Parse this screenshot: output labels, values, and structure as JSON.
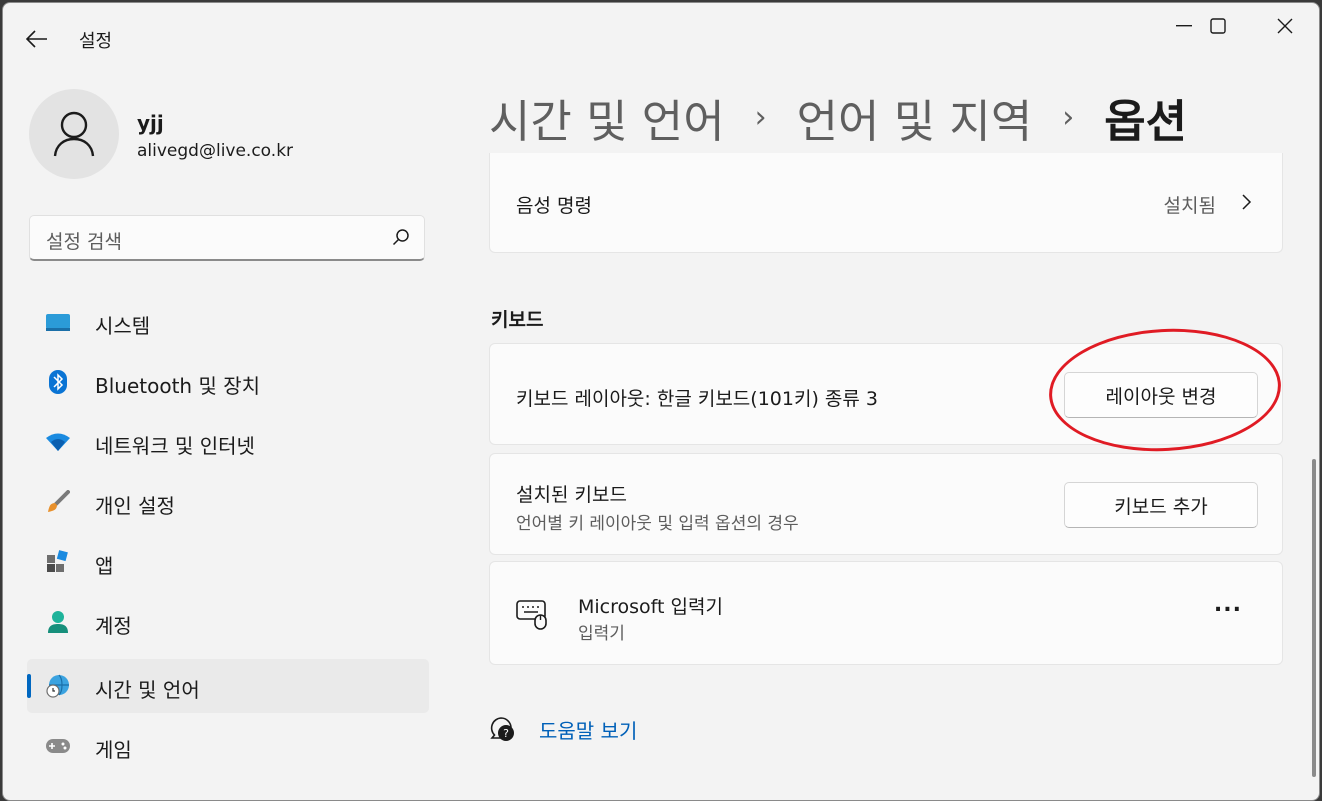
{
  "window": {
    "title": "설정"
  },
  "profile": {
    "name": "yjj",
    "email": "alivegd@live.co.kr"
  },
  "search": {
    "placeholder": "설정 검색"
  },
  "nav": {
    "items": [
      {
        "label": "시스템",
        "icon": "system-icon"
      },
      {
        "label": "Bluetooth 및 장치",
        "icon": "bluetooth-icon"
      },
      {
        "label": "네트워크 및 인터넷",
        "icon": "wifi-icon"
      },
      {
        "label": "개인 설정",
        "icon": "brush-icon"
      },
      {
        "label": "앱",
        "icon": "apps-icon"
      },
      {
        "label": "계정",
        "icon": "account-icon"
      },
      {
        "label": "시간 및 언어",
        "icon": "time-language-icon",
        "selected": true
      },
      {
        "label": "게임",
        "icon": "gamepad-icon"
      }
    ]
  },
  "breadcrumb": {
    "items": [
      "시간 및 언어",
      "언어 및 지역",
      "옵션"
    ]
  },
  "speech": {
    "label": "음성 명령",
    "status": "설치됨"
  },
  "keyboard": {
    "section_title": "키보드",
    "layout_label": "키보드 레이아웃: 한글 키보드(101키) 종류 3",
    "layout_button": "레이아웃 변경",
    "installed_title": "설치된 키보드",
    "installed_desc": "언어별 키 레이아웃 및 입력 옵션의 경우",
    "add_button": "키보드 추가",
    "ime_title": "Microsoft 입력기",
    "ime_sub": "입력기",
    "more_label": "..."
  },
  "help": {
    "label": "도움말 보기"
  },
  "colors": {
    "accent": "#0067c0",
    "link": "#0060b8",
    "annotation": "#e01b24"
  }
}
